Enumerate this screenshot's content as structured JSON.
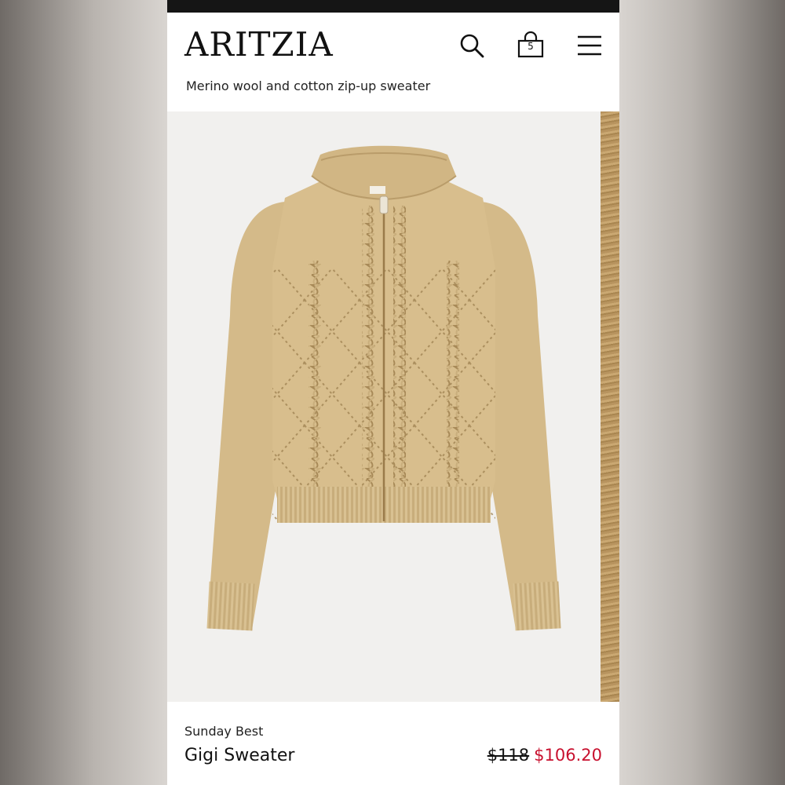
{
  "header": {
    "logo": "ARITZIA",
    "bag_count": "5",
    "icons": {
      "search": "search-icon",
      "bag": "shopping-bag-icon",
      "menu": "hamburger-menu-icon"
    }
  },
  "product": {
    "subtitle": "Merino wool and cotton zip-up sweater",
    "brand": "Sunday Best",
    "name": "Gigi Sweater",
    "original_price": "$118",
    "sale_price": "$106.20",
    "image_alt": "Beige cable knit zip-up sweater"
  },
  "colors": {
    "sale": "#c8102e",
    "sweater": "#d6bd8c",
    "gallery_bg": "#f1f0ee"
  }
}
